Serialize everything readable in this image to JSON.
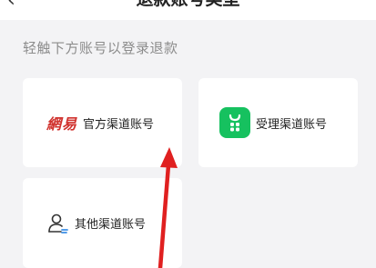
{
  "header": {
    "back_icon": "‹",
    "title": "退款账号类型"
  },
  "hint": "轻触下方账号以登录退款",
  "cards": {
    "official": {
      "logo_text": "網易",
      "label": "官方渠道账号"
    },
    "acceptance": {
      "label": "受理渠道账号"
    },
    "other": {
      "label": "其他渠道账号"
    }
  },
  "colors": {
    "background": "#f3f3f5",
    "card": "#ffffff",
    "accent_green": "#16c15f",
    "logo_red": "#d0312d",
    "annotation_arrow": "#e02020"
  }
}
